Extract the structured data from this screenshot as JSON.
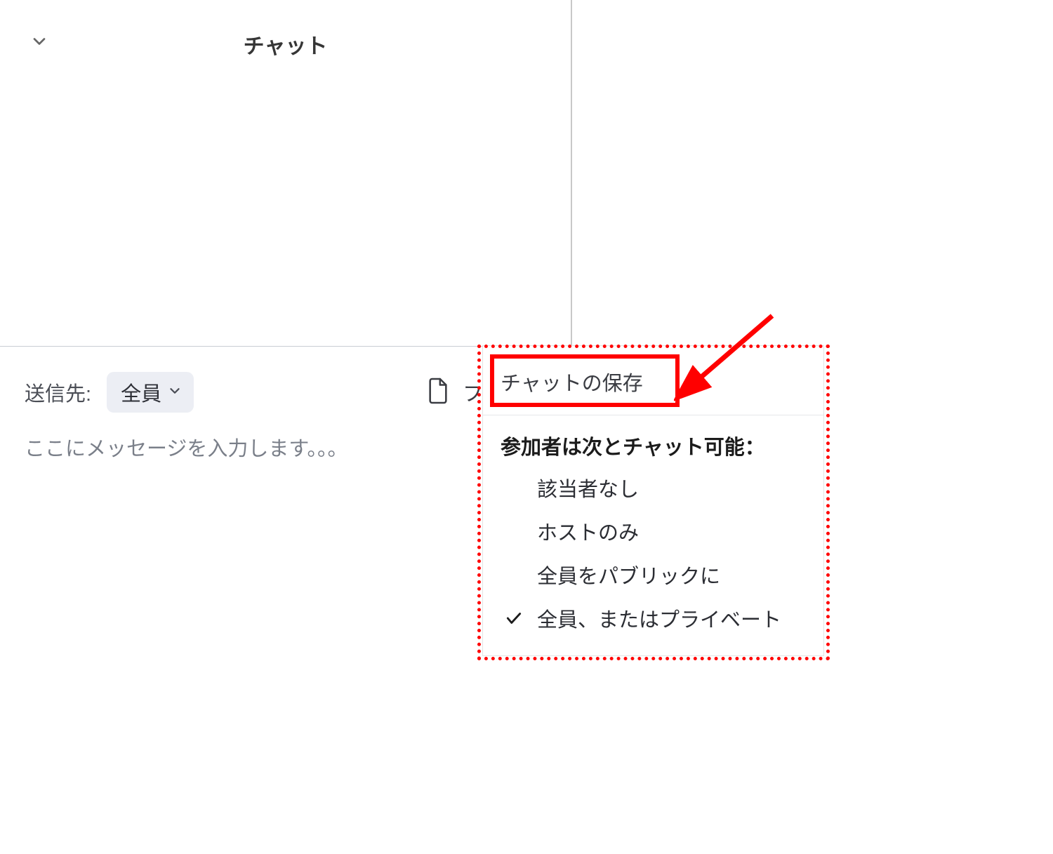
{
  "header": {
    "title": "チャット"
  },
  "footer": {
    "sendto_label": "送信先:",
    "sendto_value": "全員",
    "file_label": "ファイル",
    "input_placeholder": "ここにメッセージを入力します。。。"
  },
  "popup": {
    "save_label": "チャットの保存",
    "section_title": "参加者は次とチャット可能：",
    "options": [
      {
        "label": "該当者なし",
        "checked": false
      },
      {
        "label": "ホストのみ",
        "checked": false
      },
      {
        "label": "全員をパブリックに",
        "checked": false
      },
      {
        "label": "全員、またはプライベート",
        "checked": true
      }
    ]
  }
}
